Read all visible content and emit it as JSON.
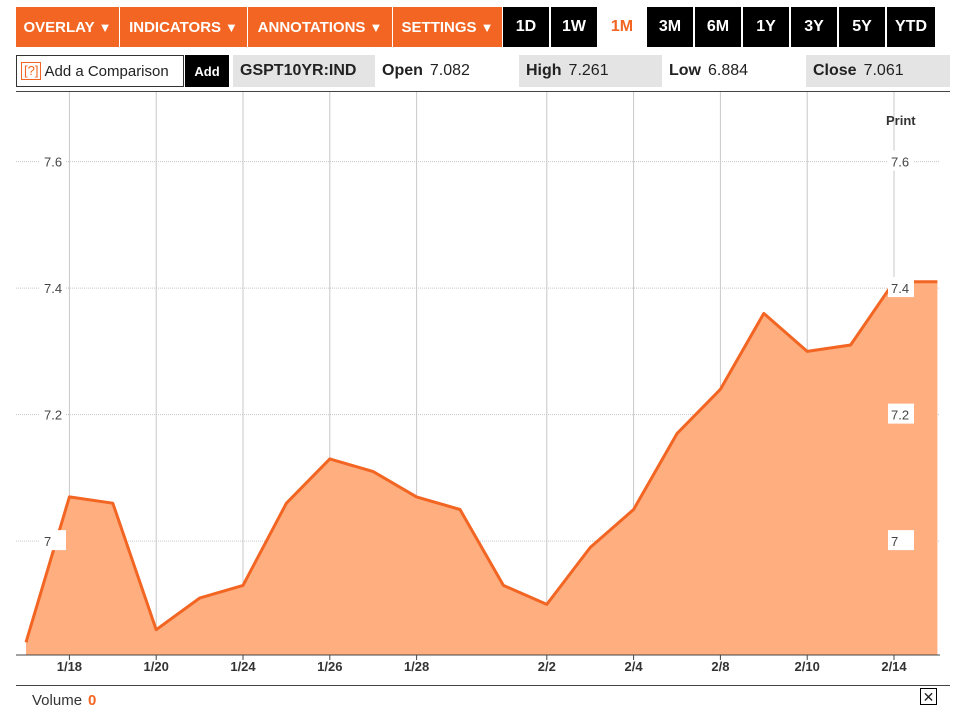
{
  "toolbar": {
    "menus": [
      "OVERLAY",
      "INDICATORS",
      "ANNOTATIONS",
      "SETTINGS"
    ],
    "ranges": [
      "1D",
      "1W",
      "1M",
      "3M",
      "6M",
      "1Y",
      "3Y",
      "5Y",
      "YTD"
    ],
    "active_range": "1M",
    "accent_color": "#f26522"
  },
  "compare": {
    "help": "[?]",
    "placeholder": "Add a Comparison",
    "add_label": "Add"
  },
  "quote": {
    "symbol": "GSPT10YR:IND",
    "open_label": "Open",
    "open_value": "7.082",
    "high_label": "High",
    "high_value": "7.261",
    "low_label": "Low",
    "low_value": "6.884",
    "close_label": "Close",
    "close_value": "7.061"
  },
  "print_label": "Print",
  "volume": {
    "label": "Volume",
    "value": "0"
  },
  "close_icon": "close-icon",
  "chart_data": {
    "type": "area",
    "line_color": "#f26522",
    "fill_color": "#ffae80",
    "y_ticks": [
      "7",
      "7.2",
      "7.4",
      "7.6"
    ],
    "y_tick_values": [
      7.0,
      7.2,
      7.4,
      7.6
    ],
    "ylim": [
      6.82,
      7.71
    ],
    "x_tick_labels": [
      "1/18",
      "1/20",
      "1/24",
      "1/26",
      "1/28",
      "2/2",
      "2/4",
      "2/8",
      "2/10",
      "2/14"
    ],
    "grid": true,
    "x": [
      -1.0,
      0.0,
      1.0,
      2.0,
      3.0,
      4.0,
      5.0,
      6.0,
      7.0,
      8.0,
      9.0,
      10.0,
      11.0,
      12.0,
      13.0,
      14.0,
      15.0,
      16.0,
      17.0,
      18.0,
      19.0,
      20.0
    ],
    "values": [
      6.84,
      7.07,
      7.06,
      6.86,
      6.91,
      6.93,
      7.06,
      7.13,
      7.11,
      7.07,
      7.05,
      6.93,
      6.9,
      6.99,
      7.05,
      7.17,
      7.24,
      7.36,
      7.3,
      7.31,
      7.41,
      7.41
    ]
  }
}
